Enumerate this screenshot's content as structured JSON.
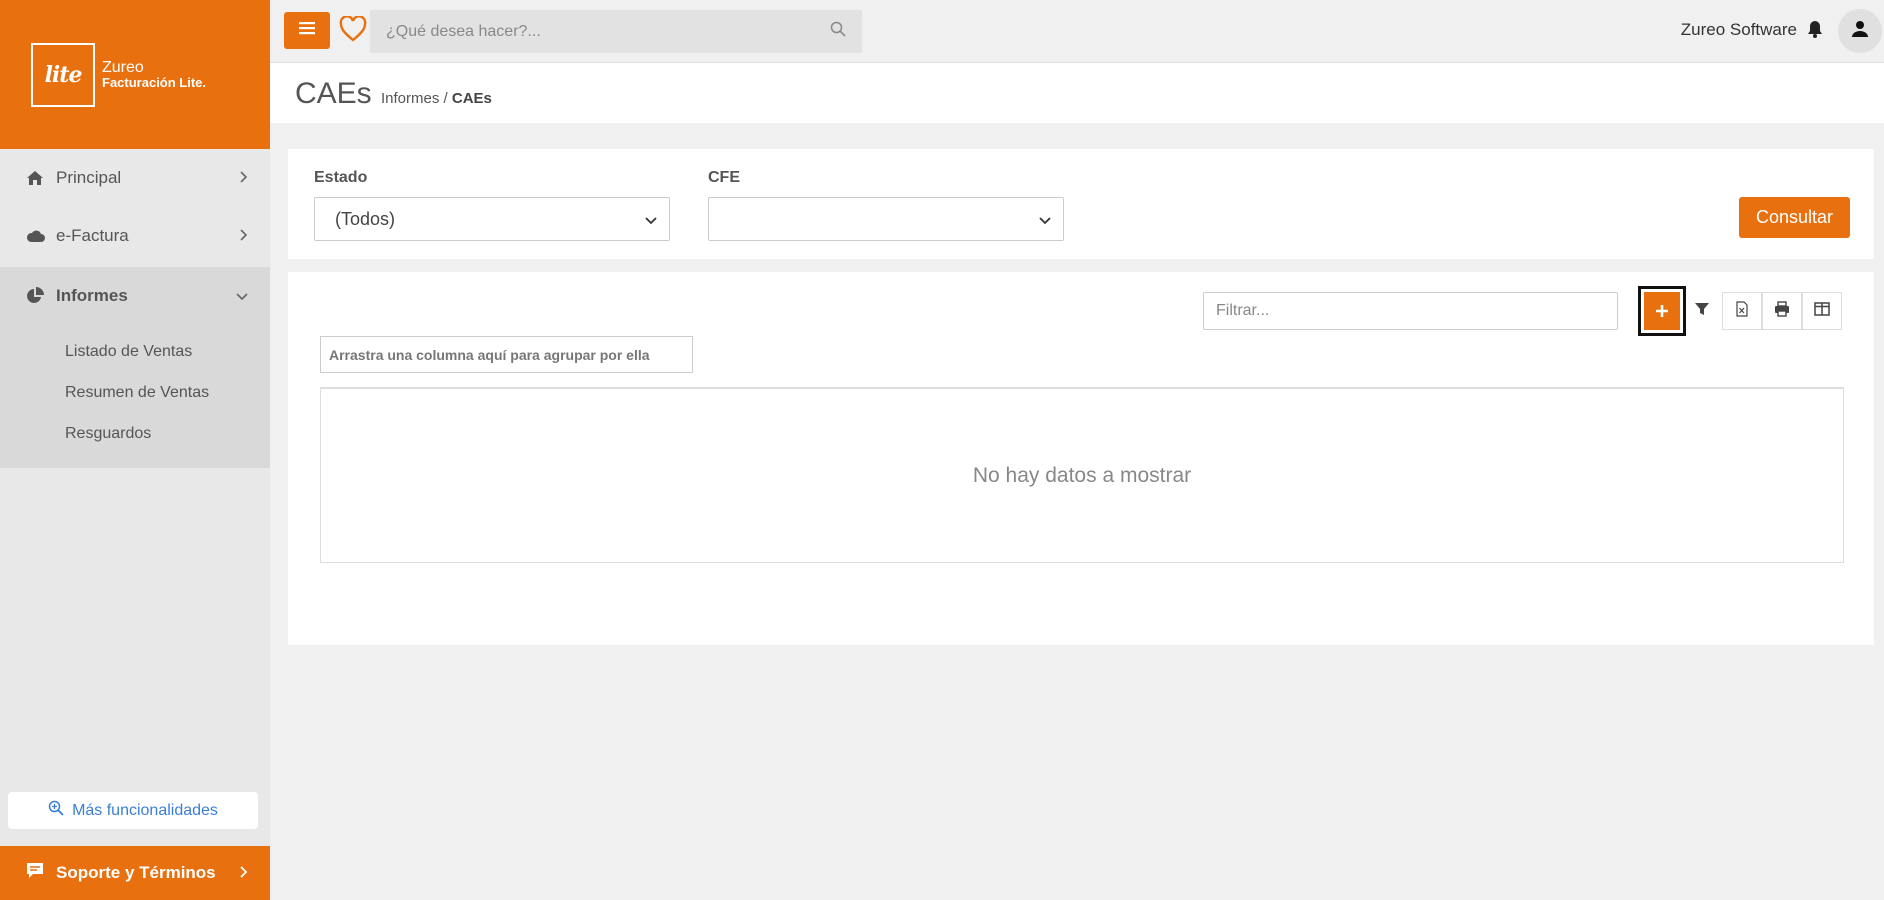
{
  "sidebar": {
    "logo": {
      "mark": "lite",
      "line1": "Zureo",
      "line2": "Facturación Lite."
    },
    "items": [
      {
        "label": "Principal",
        "icon": "home-icon"
      },
      {
        "label": "e-Factura",
        "icon": "cloud-icon"
      },
      {
        "label": "Informes",
        "icon": "pie-chart-icon",
        "expanded": true
      }
    ],
    "subitems": [
      {
        "label": "Listado de Ventas"
      },
      {
        "label": "Resumen de Ventas"
      },
      {
        "label": "Resguardos"
      }
    ],
    "more_label": "Más funcionalidades",
    "support_label": "Soporte y Términos"
  },
  "topbar": {
    "search_placeholder": "¿Qué desea hacer?...",
    "user_name": "Zureo Software"
  },
  "header": {
    "title": "CAEs",
    "breadcrumb_parent": "Informes",
    "breadcrumb_separator": " / ",
    "breadcrumb_current": "CAEs"
  },
  "filters": {
    "estado_label": "Estado",
    "estado_value": "(Todos)",
    "cfe_label": "CFE",
    "cfe_value": "",
    "consult_label": "Consultar"
  },
  "grid": {
    "filter_placeholder": "Filtrar...",
    "group_hint": "Arrastra una columna aquí para agrupar por ella",
    "empty_message": "No hay datos a mostrar"
  },
  "colors": {
    "accent": "#e8700e",
    "link": "#3a7fd5"
  }
}
